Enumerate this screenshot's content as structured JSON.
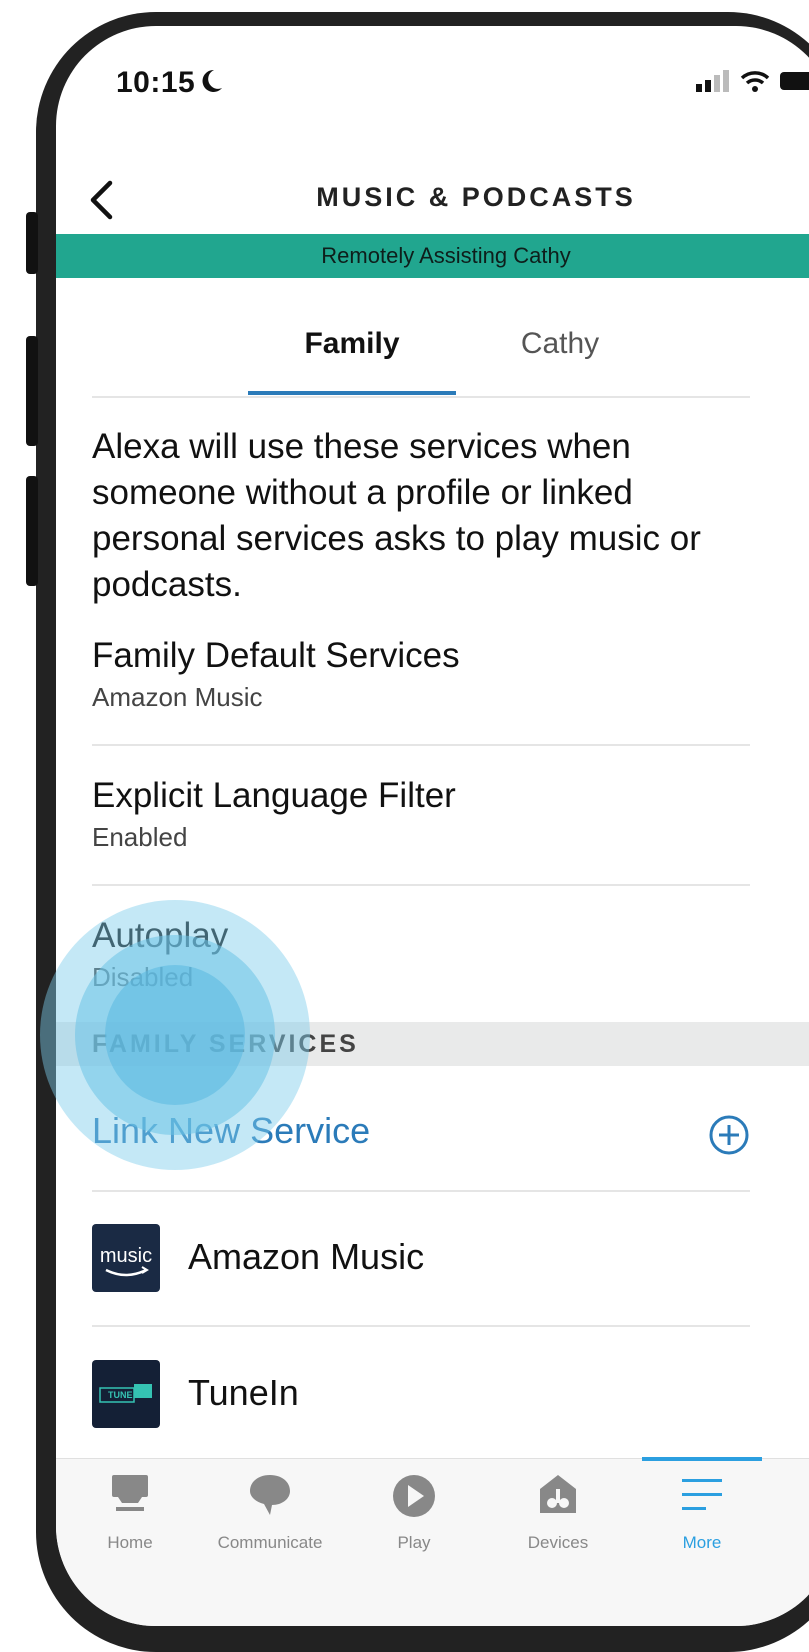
{
  "status_bar": {
    "time": "10:15"
  },
  "nav": {
    "title": "MUSIC & PODCASTS"
  },
  "banner": {
    "text": "Remotely Assisting Cathy"
  },
  "tabs": [
    {
      "label": "Family",
      "active": true
    },
    {
      "label": "Cathy",
      "active": false
    }
  ],
  "description": "Alexa will use these services when someone without a profile or linked personal services asks to play music or podcasts.",
  "settings": [
    {
      "label": "Family Default Services",
      "value": "Amazon Music"
    },
    {
      "label": "Explicit Language Filter",
      "value": "Enabled"
    },
    {
      "label": "Autoplay",
      "value": "Disabled"
    }
  ],
  "section_header": "FAMILY SERVICES",
  "link_service": {
    "label": "Link New Service"
  },
  "services": [
    {
      "name": "Amazon Music",
      "logo_text": "music"
    },
    {
      "name": "TuneIn",
      "logo_text": "TUNE IN"
    }
  ],
  "tabbar": [
    {
      "label": "Home",
      "icon": "home-icon"
    },
    {
      "label": "Communicate",
      "icon": "chat-bubble-icon"
    },
    {
      "label": "Play",
      "icon": "play-icon"
    },
    {
      "label": "Devices",
      "icon": "devices-icon"
    },
    {
      "label": "More",
      "icon": "hamburger-menu-icon",
      "active": true
    }
  ],
  "colors": {
    "accent": "#2b7bb9",
    "banner": "#21a68f",
    "active_tab": "#2b9fe0",
    "touch_indicator": "#7dcbea"
  }
}
